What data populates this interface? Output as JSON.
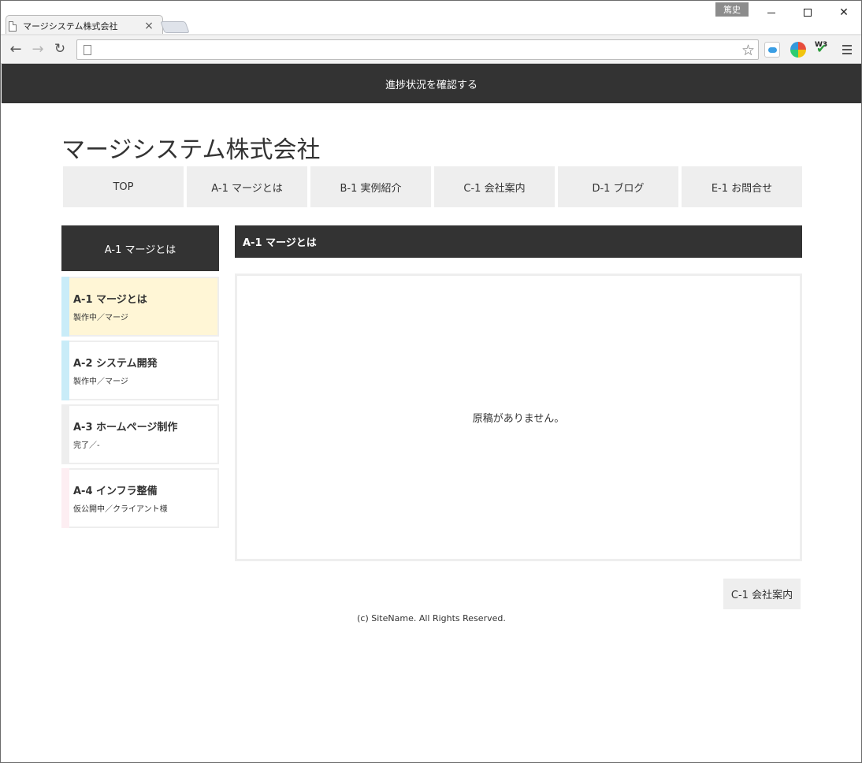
{
  "browser": {
    "tab_title": "マージシステム株式会社",
    "tab_close": "×",
    "user_badge": "篤史",
    "address_value": ""
  },
  "page": {
    "topbar_text": "進捗状況を確認する",
    "site_title": "マージシステム株式会社",
    "gnav": [
      {
        "label": "TOP"
      },
      {
        "label": "A-1 マージとは"
      },
      {
        "label": "B-1 実例紹介"
      },
      {
        "label": "C-1 会社案内"
      },
      {
        "label": "D-1 ブログ"
      },
      {
        "label": "E-1 お問合せ"
      }
    ],
    "sidebar": {
      "heading": "A-1 マージとは",
      "items": [
        {
          "title": "A-1 マージとは",
          "sub": "製作中／マージ",
          "accent": "#c9ecf8",
          "bg": "#fff6d6"
        },
        {
          "title": "A-2 システム開発",
          "sub": "製作中／マージ",
          "accent": "#c9ecf8",
          "bg": "#ffffff"
        },
        {
          "title": "A-3 ホームページ制作",
          "sub": "完了／-",
          "accent": "#eeeeee",
          "bg": "#ffffff"
        },
        {
          "title": "A-4 インフラ整備",
          "sub": "仮公開中／クライアント様",
          "accent": "#fdeef2",
          "bg": "#ffffff"
        }
      ]
    },
    "main": {
      "heading": "A-1 マージとは",
      "empty_message": "原稿がありません。"
    },
    "next_button": "C-1 会社案内",
    "copyright": "(c) SiteName. All Rights Reserved."
  },
  "colors": {
    "dark": "#333333",
    "light_gray": "#eeeeee"
  }
}
